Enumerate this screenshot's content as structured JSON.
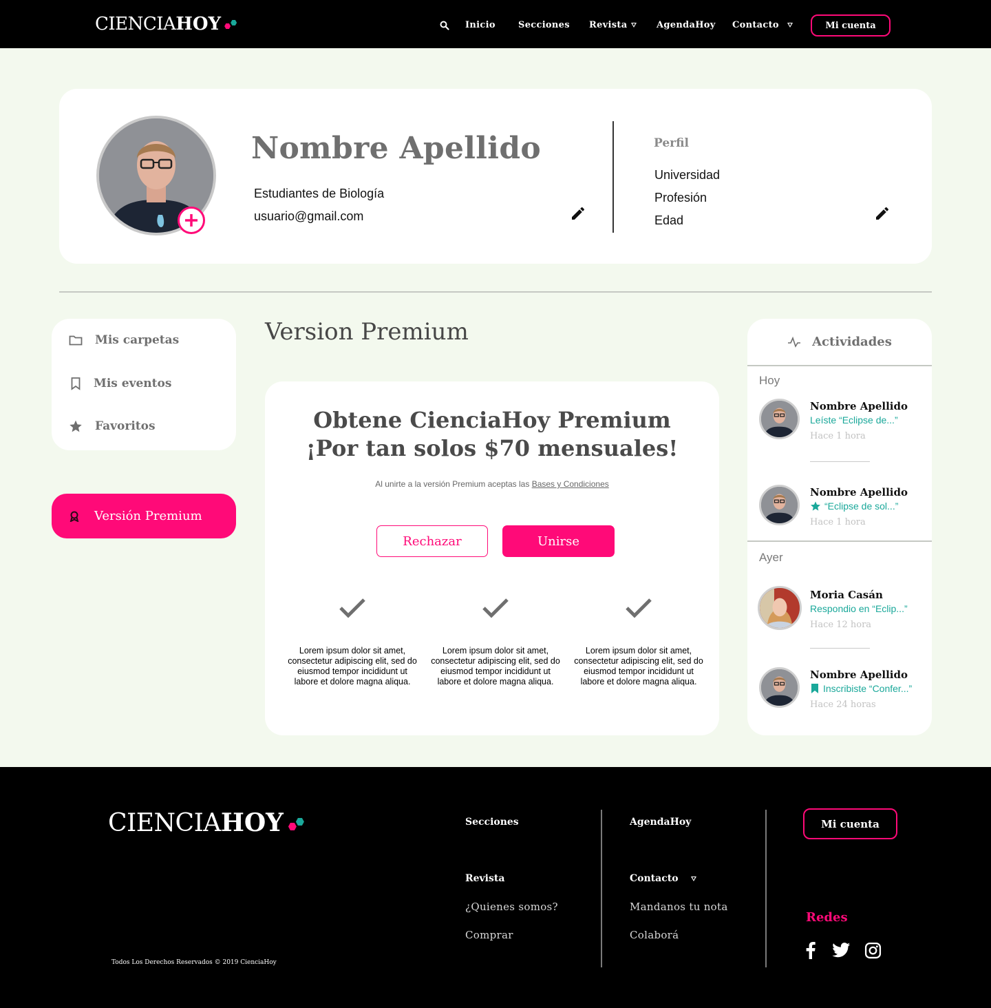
{
  "colors": {
    "accent": "#ff0a78",
    "teal": "#1aa89a",
    "background": "#f3f9ee"
  },
  "header": {
    "logo_part1": "CIENCIA",
    "logo_part2": "HOY",
    "nav": {
      "search_icon": "search-icon",
      "inicio": "Inicio",
      "secciones": "Secciones",
      "revista": "Revista",
      "agenda": "AgendaHoy",
      "contacto": "Contacto"
    },
    "account_button": "Mi cuenta"
  },
  "profile": {
    "name": "Nombre Apellido",
    "group": "Estudiantes de Biología",
    "email": "usuario@gmail.com",
    "section_label": "Perfil",
    "fields": [
      "Universidad",
      "Profesión",
      "Edad"
    ]
  },
  "sidebar": {
    "items": [
      {
        "label": "Mis carpetas",
        "icon": "folder-icon"
      },
      {
        "label": "Mis eventos",
        "icon": "bookmark-icon"
      },
      {
        "label": "Favoritos",
        "icon": "star-icon"
      }
    ],
    "premium_label": "Versión Premium"
  },
  "main": {
    "title": "Version Premium",
    "offer_line1": "Obtene CienciaHoy Premium",
    "offer_line2": "¡Por tan solos $70 mensuales!",
    "terms_prefix": "Al unirte a la versión Premium aceptas las",
    "terms_link": "Bases y Condiciones",
    "reject_label": "Rechazar",
    "join_label": "Unirse",
    "features": [
      "Lorem ipsum dolor sit amet, consectetur adipiscing elit, sed do eiusmod tempor incididunt ut labore et dolore magna aliqua.",
      "Lorem ipsum dolor sit amet, consectetur adipiscing elit, sed do eiusmod tempor incididunt ut labore et dolore magna aliqua.",
      "Lorem ipsum dolor sit amet, consectetur adipiscing elit, sed do eiusmod tempor incididunt ut labore et dolore magna aliqua."
    ]
  },
  "activities": {
    "title": "Actividades",
    "today_label": "Hoy",
    "yesterday_label": "Ayer",
    "items": [
      {
        "name": "Nombre Apellido",
        "desc": "Leíste “Eclipse de...”",
        "time": "Hace 1 hora",
        "icon": ""
      },
      {
        "name": "Nombre Apellido",
        "desc": "“Eclipse de sol...”",
        "time": "Hace 1 hora",
        "icon": "star-icon"
      },
      {
        "name": "Moria Casán",
        "desc": "Respondio en “Eclip...”",
        "time": "Hace 12 hora",
        "icon": ""
      },
      {
        "name": "Nombre Apellido",
        "desc": "Inscribiste “Confer...”",
        "time": "Hace 24 horas",
        "icon": "bookmark-icon"
      }
    ]
  },
  "footer": {
    "logo_part1": "CIENCIA",
    "logo_part2": "HOY",
    "col1": {
      "secciones": "Secciones",
      "revista": "Revista",
      "quienes": "¿Quienes somos?",
      "comprar": "Comprar"
    },
    "col2": {
      "agenda": "AgendaHoy",
      "contacto": "Contacto",
      "nota": "Mandanos tu nota",
      "colabora": "Colaborá"
    },
    "account_button": "Mi cuenta",
    "redes_label": "Redes",
    "social_icons": [
      "facebook-icon",
      "twitter-icon",
      "instagram-icon"
    ],
    "copyright": "Todos Los Derechos Reservados © 2019 CienciaHoy"
  }
}
